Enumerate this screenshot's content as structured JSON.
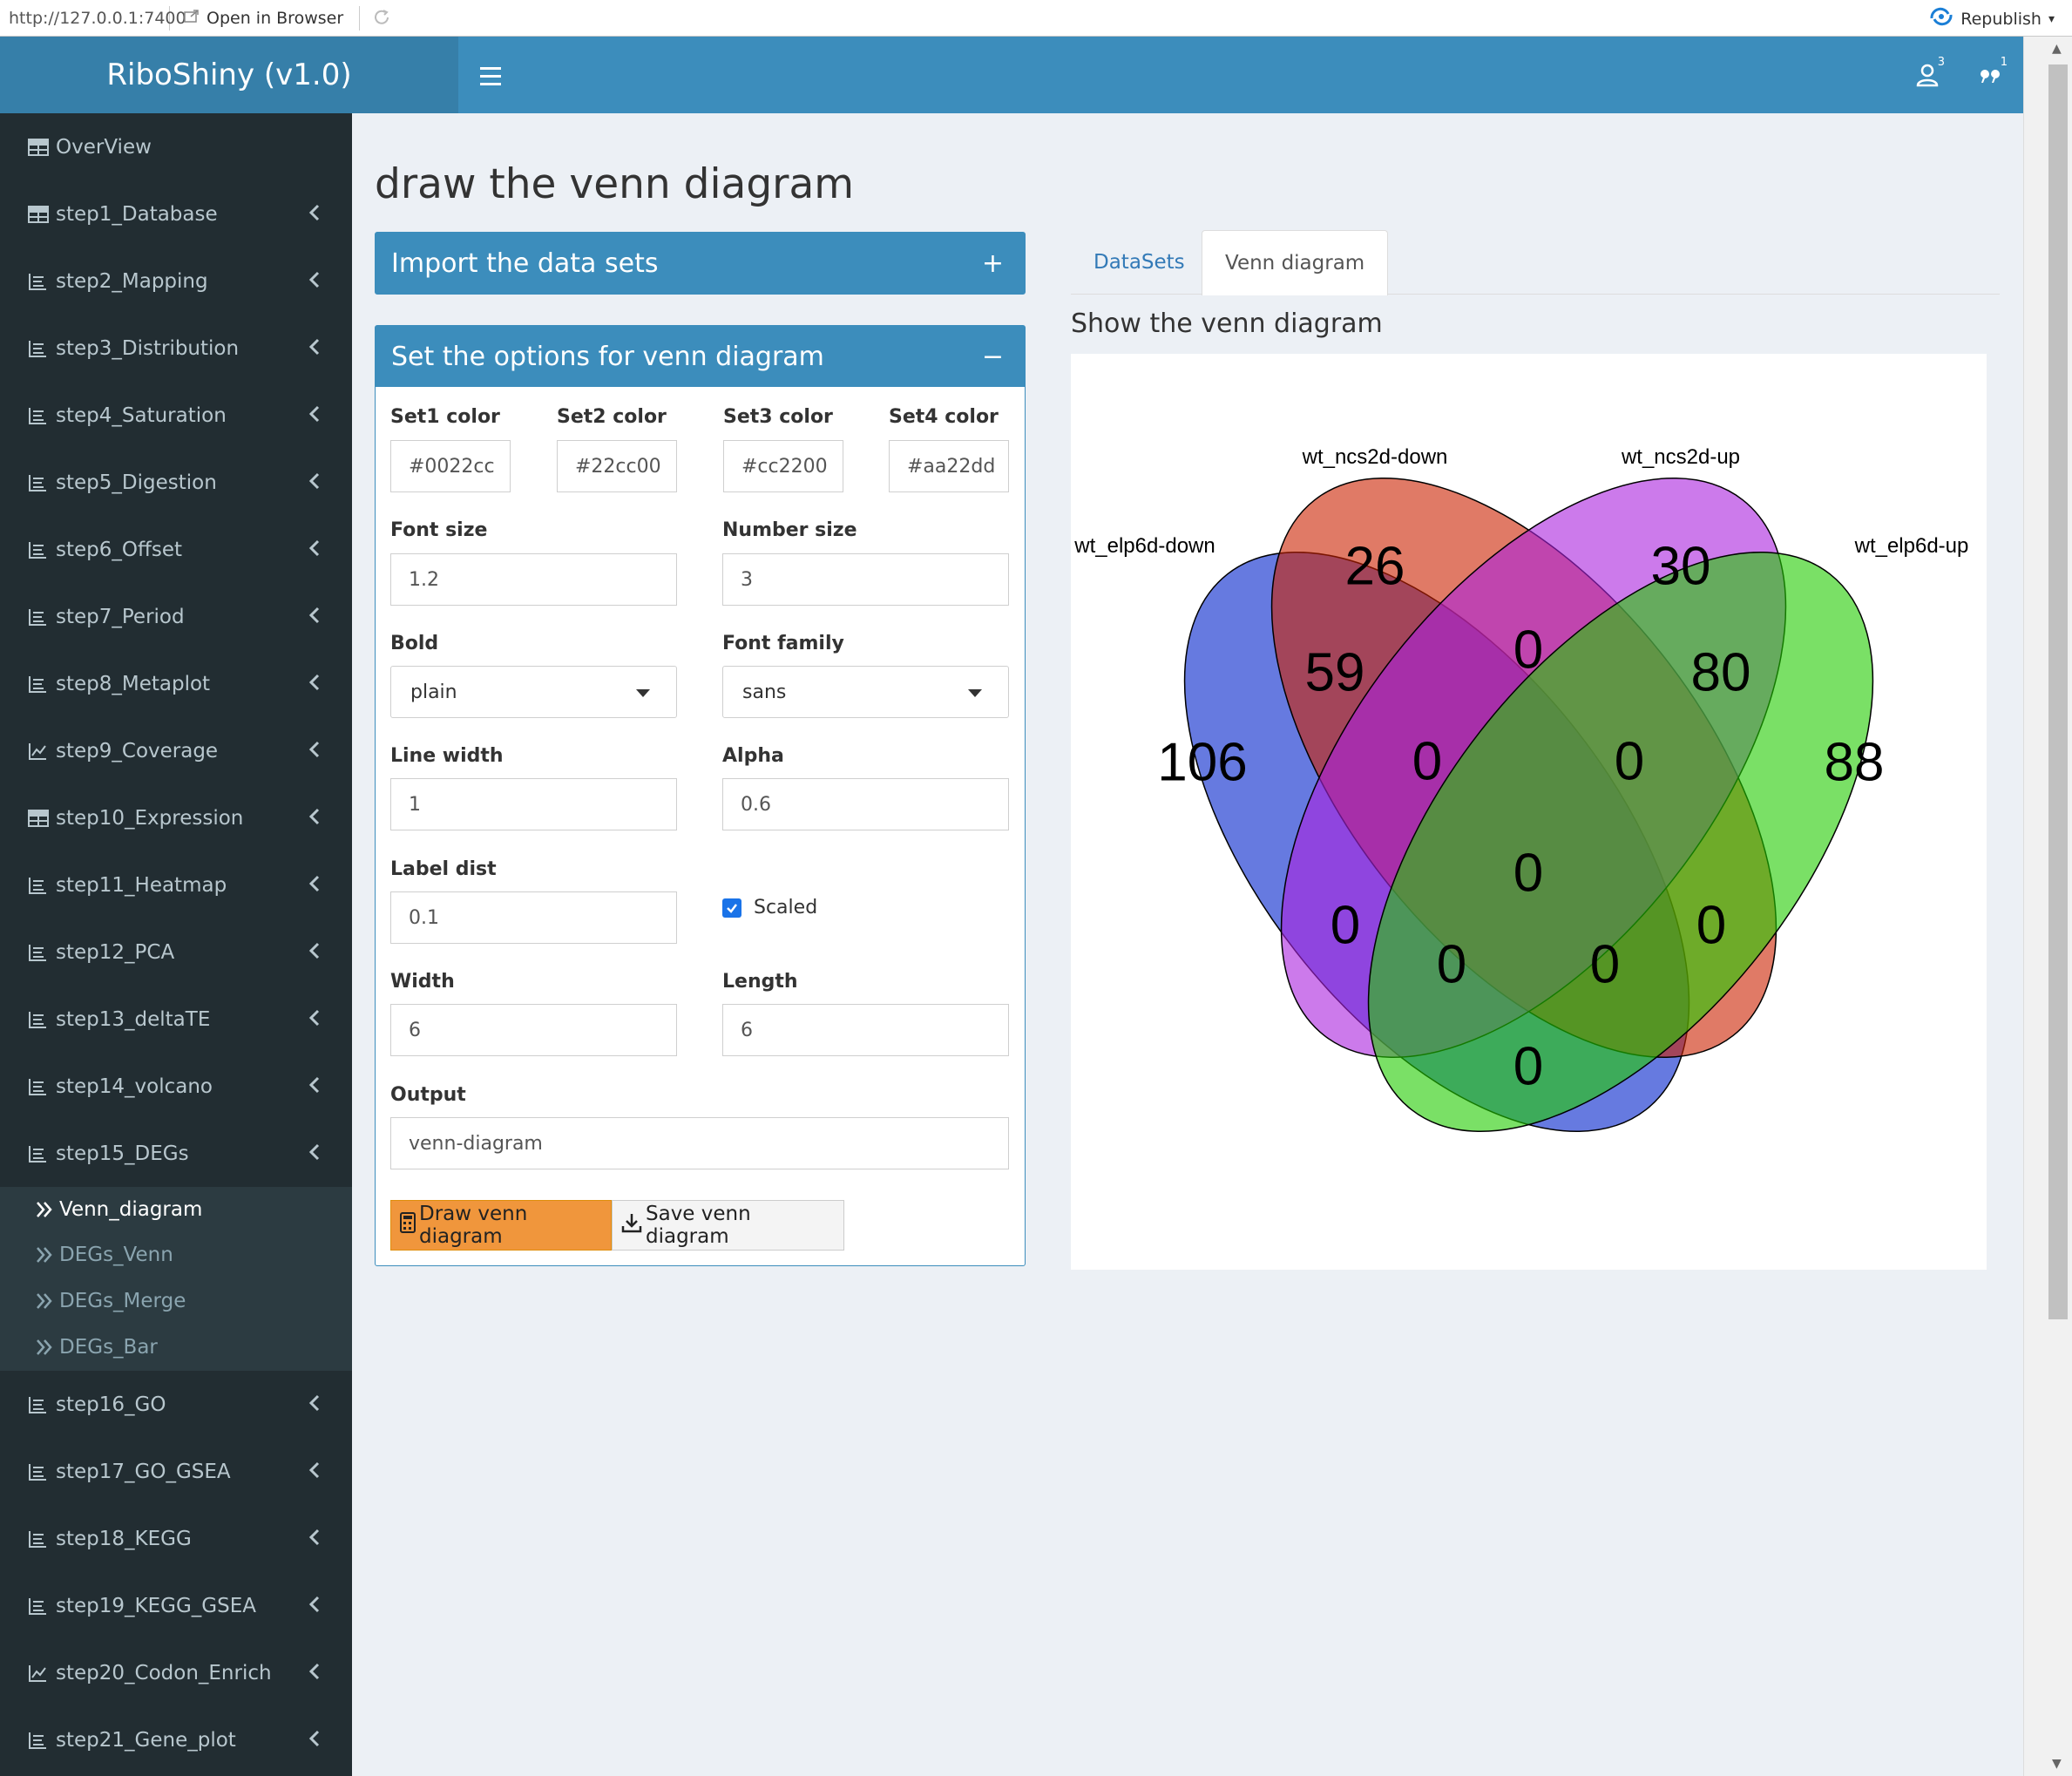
{
  "browser": {
    "url": "http://127.0.0.1:7400",
    "open_label": "Open in Browser",
    "republish_label": "Republish"
  },
  "header": {
    "title": "RiboShiny (v1.0)",
    "users_badge": "3",
    "messages_badge": "1"
  },
  "sidebar": {
    "items": [
      {
        "label": "OverView",
        "icon": "table-icon"
      },
      {
        "label": "step1_Database",
        "icon": "table-icon"
      },
      {
        "label": "step2_Mapping",
        "icon": "list-icon"
      },
      {
        "label": "step3_Distribution",
        "icon": "list-icon"
      },
      {
        "label": "step4_Saturation",
        "icon": "list-icon"
      },
      {
        "label": "step5_Digestion",
        "icon": "list-icon"
      },
      {
        "label": "step6_Offset",
        "icon": "list-icon"
      },
      {
        "label": "step7_Period",
        "icon": "list-icon"
      },
      {
        "label": "step8_Metaplot",
        "icon": "list-icon"
      },
      {
        "label": "step9_Coverage",
        "icon": "line-chart-icon"
      },
      {
        "label": "step10_Expression",
        "icon": "table-icon"
      },
      {
        "label": "step11_Heatmap",
        "icon": "list-icon"
      },
      {
        "label": "step12_PCA",
        "icon": "list-icon"
      },
      {
        "label": "step13_deltaTE",
        "icon": "list-icon"
      },
      {
        "label": "step14_volcano",
        "icon": "list-icon"
      },
      {
        "label": "step15_DEGs",
        "icon": "list-icon"
      },
      {
        "label": "step16_GO",
        "icon": "list-icon"
      },
      {
        "label": "step17_GO_GSEA",
        "icon": "list-icon"
      },
      {
        "label": "step18_KEGG",
        "icon": "list-icon"
      },
      {
        "label": "step19_KEGG_GSEA",
        "icon": "list-icon"
      },
      {
        "label": "step20_Codon_Enrich",
        "icon": "line-chart-icon"
      },
      {
        "label": "step21_Gene_plot",
        "icon": "list-icon"
      }
    ],
    "subitems": [
      {
        "label": "Venn_diagram",
        "active": true
      },
      {
        "label": "DEGs_Venn",
        "active": false
      },
      {
        "label": "DEGs_Merge",
        "active": false
      },
      {
        "label": "DEGs_Bar",
        "active": false
      }
    ]
  },
  "page": {
    "title": "draw the venn diagram"
  },
  "import_box": {
    "title": "Import the data sets",
    "tool": "+"
  },
  "options_box": {
    "title": "Set the options for venn diagram",
    "tool": "−",
    "set1_label": "Set1 color",
    "set1_value": "#0022cc",
    "set2_label": "Set2 color",
    "set2_value": "#22cc00",
    "set3_label": "Set3 color",
    "set3_value": "#cc2200",
    "set4_label": "Set4 color",
    "set4_value": "#aa22dd",
    "font_size_label": "Font size",
    "font_size_value": "1.2",
    "number_size_label": "Number size",
    "number_size_value": "3",
    "bold_label": "Bold",
    "bold_value": "plain",
    "font_family_label": "Font family",
    "font_family_value": "sans",
    "line_width_label": "Line width",
    "line_width_value": "1",
    "alpha_label": "Alpha",
    "alpha_value": "0.6",
    "label_dist_label": "Label dist",
    "label_dist_value": "0.1",
    "scaled_label": "Scaled",
    "scaled_checked": true,
    "width_label": "Width",
    "width_value": "6",
    "length_label": "Length",
    "length_value": "6",
    "output_label": "Output",
    "output_value": "venn-diagram",
    "draw_button": "Draw venn diagram",
    "save_button": "Save venn diagram"
  },
  "tabs": {
    "datasets": "DataSets",
    "venn": "Venn diagram",
    "active": "venn"
  },
  "plot": {
    "heading": "Show the venn diagram"
  },
  "venn": {
    "sets": [
      {
        "name": "wt_elp6d-down",
        "color": "#0022cc"
      },
      {
        "name": "wt_ncs2d-down",
        "color": "#cc2200"
      },
      {
        "name": "wt_ncs2d-up",
        "color": "#aa22dd"
      },
      {
        "name": "wt_elp6d-up",
        "color": "#22cc00"
      }
    ],
    "alpha": 0.6,
    "counts": {
      "A": "106",
      "B": "26",
      "C": "30",
      "D": "88",
      "AB": "59",
      "BC": "0",
      "CD": "80",
      "ABC": "0",
      "BCD": "0",
      "ABCD": "0",
      "AC": "0",
      "BD": "0",
      "ACD": "0",
      "ABD": "0",
      "AD": "0"
    }
  }
}
